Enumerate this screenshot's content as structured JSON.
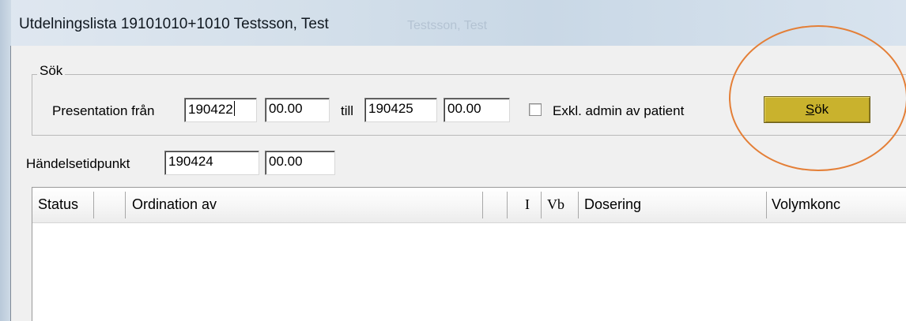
{
  "window": {
    "title": "Utdelningslista  19101010+1010 Testsson, Test",
    "title_ghost": "Testsson, Test"
  },
  "search_group": {
    "legend": "Sök",
    "presentation_from_label": "Presentation från",
    "from_date": "190422",
    "from_time": "00.00",
    "to_label": "till",
    "to_date": "190425",
    "to_time": "00.00",
    "exclude_checkbox_label": "Exkl. admin av patient",
    "exclude_checked": false,
    "search_button_label": "Sök",
    "search_button_mnemonic": "S",
    "search_button_rest": "ök"
  },
  "event": {
    "label": "Händelsetidpunkt",
    "date": "190424",
    "time": "00.00"
  },
  "table": {
    "columns": [
      "Status",
      "",
      "Ordination av",
      "",
      "I",
      "Vb",
      "Dosering",
      "Volymkonc"
    ],
    "rows": []
  },
  "colors": {
    "search_button": "#c9b22d",
    "annotation_circle": "#e47f37",
    "titlebar": "#d3dfea"
  }
}
